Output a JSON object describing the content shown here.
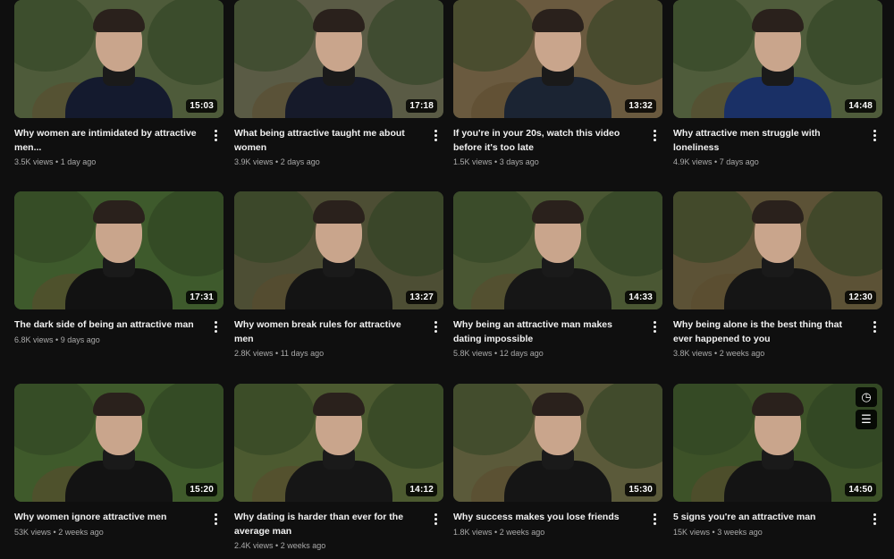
{
  "videos": [
    {
      "title": "Why women are intimidated by attractive men...",
      "views": "3.5K views",
      "age": "1 day ago",
      "duration": "15:03",
      "bg": "#4e5b3a",
      "shirt": "#141a2e"
    },
    {
      "title": "What being attractive taught me about women",
      "views": "3.9K views",
      "age": "2 days ago",
      "duration": "17:18",
      "bg": "#5a5b45",
      "shirt": "#161a2a"
    },
    {
      "title": "If you're in your 20s, watch this video before it's too late",
      "views": "1.5K views",
      "age": "3 days ago",
      "duration": "13:32",
      "bg": "#6a5a3f",
      "shirt": "#1b2433"
    },
    {
      "title": "Why attractive men struggle with loneliness",
      "views": "4.9K views",
      "age": "7 days ago",
      "duration": "14:48",
      "bg": "#4f5c3b",
      "shirt": "#1a3066"
    },
    {
      "title": "The dark side of being an attractive man",
      "views": "6.8K views",
      "age": "9 days ago",
      "duration": "17:31",
      "bg": "#3e5a2c",
      "shirt": "#121212"
    },
    {
      "title": "Why women break rules for attractive men",
      "views": "2.8K views",
      "age": "11 days ago",
      "duration": "13:27",
      "bg": "#4d4e34",
      "shirt": "#141414"
    },
    {
      "title": "Why being an attractive man makes dating impossible",
      "views": "5.8K views",
      "age": "12 days ago",
      "duration": "14:33",
      "bg": "#4a5733",
      "shirt": "#161616"
    },
    {
      "title": "Why being alone is the best thing that ever happened to you",
      "views": "3.8K views",
      "age": "2 weeks ago",
      "duration": "12:30",
      "bg": "#5c5236",
      "shirt": "#151515"
    },
    {
      "title": "Why women ignore attractive men",
      "views": "53K views",
      "age": "2 weeks ago",
      "duration": "15:20",
      "bg": "#3f5a2b",
      "shirt": "#131313"
    },
    {
      "title": "Why dating is harder than ever for the average man",
      "views": "2.4K views",
      "age": "2 weeks ago",
      "duration": "14:12",
      "bg": "#4c5a30",
      "shirt": "#161616"
    },
    {
      "title": "Why success makes you lose friends",
      "views": "1.8K views",
      "age": "2 weeks ago",
      "duration": "15:30",
      "bg": "#5b5a3a",
      "shirt": "#151515"
    },
    {
      "title": "5 signs you're an attractive man",
      "views": "15K views",
      "age": "3 weeks ago",
      "duration": "14:50",
      "bg": "#3d5228",
      "shirt": "#141414"
    }
  ],
  "hover_icons": [
    "clock-icon",
    "add-to-queue-icon"
  ],
  "separator": "•"
}
